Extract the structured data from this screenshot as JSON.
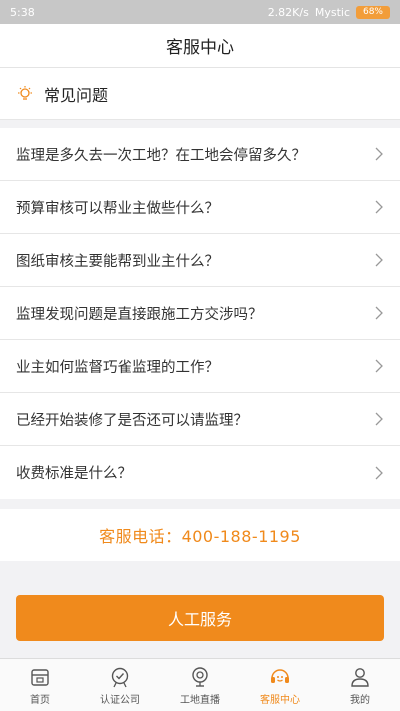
{
  "status_bar": {
    "time": "5:38",
    "network_speed": "2.82K/s",
    "carrier": "Mystic",
    "battery": "68%"
  },
  "header": {
    "title": "客服中心"
  },
  "faq": {
    "title": "常见问题",
    "items": [
      {
        "label": "监理是多久去一次工地？在工地会停留多久？"
      },
      {
        "label": "预算审核可以帮业主做些什么？"
      },
      {
        "label": "图纸审核主要能帮到业主什么？"
      },
      {
        "label": "监理发现问题是直接跟施工方交涉吗？"
      },
      {
        "label": "业主如何监督巧雀监理的工作？"
      },
      {
        "label": "已经开始装修了是否还可以请监理？"
      },
      {
        "label": "收费标准是什么？"
      }
    ]
  },
  "contact": {
    "phone_text": "客服电话：400-188-1195"
  },
  "service_button": {
    "label": "人工服务"
  },
  "tab_bar": {
    "tabs": [
      {
        "label": "首页",
        "icon": "home-icon"
      },
      {
        "label": "认证公司",
        "icon": "certified-company-icon"
      },
      {
        "label": "工地直播",
        "icon": "live-camera-icon"
      },
      {
        "label": "客服中心",
        "icon": "customer-service-icon",
        "active": true
      },
      {
        "label": "我的",
        "icon": "profile-icon"
      }
    ]
  },
  "colors": {
    "accent": "#f08a1c"
  }
}
